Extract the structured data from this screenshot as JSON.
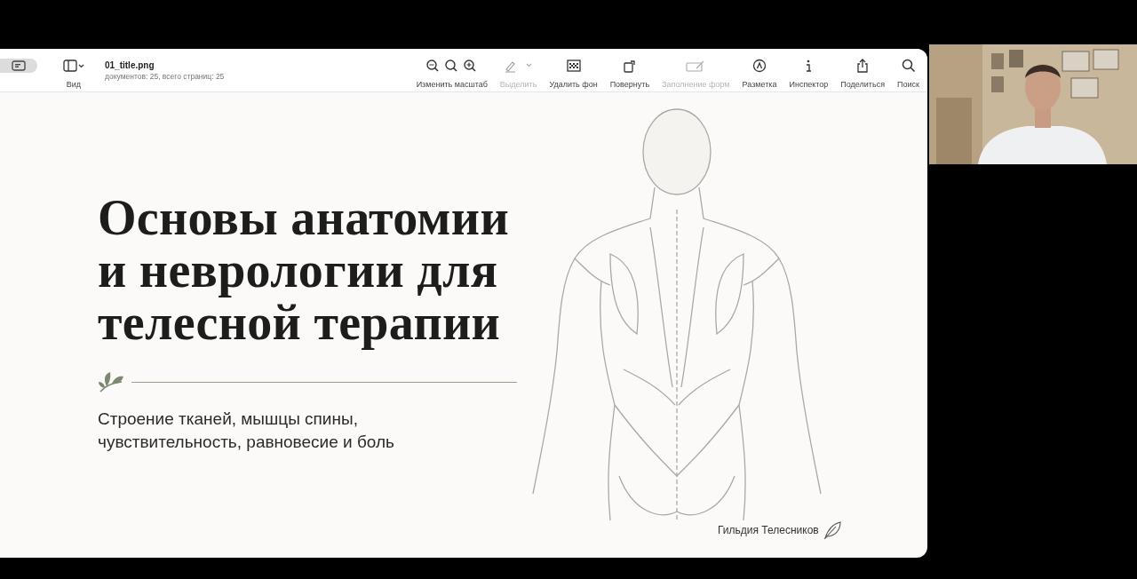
{
  "toolbar": {
    "view_label": "Вид",
    "document": {
      "title": "01_title.png",
      "subtitle": "документов: 25, всего страниц: 25"
    },
    "tools": [
      {
        "kind": "zoom",
        "label": "Изменить масштаб",
        "disabled": false
      },
      {
        "kind": "highlight",
        "label": "Выделить",
        "disabled": true
      },
      {
        "kind": "remove-background",
        "label": "Удалить фон",
        "disabled": false
      },
      {
        "kind": "rotate",
        "label": "Повернуть",
        "disabled": false
      },
      {
        "kind": "fill-form",
        "label": "Заполнение форм",
        "disabled": true
      },
      {
        "kind": "markup",
        "label": "Разметка",
        "disabled": false
      },
      {
        "kind": "inspector",
        "label": "Инспектор",
        "disabled": false
      },
      {
        "kind": "share",
        "label": "Поделиться",
        "disabled": false
      },
      {
        "kind": "search",
        "label": "Поиск",
        "disabled": false
      }
    ]
  },
  "slide": {
    "title": "Основы анатомии и неврологии для телесной терапии",
    "subtitle": "Строение тканей, мышцы спины, чувствительность, равновесие и боль",
    "author": "Гильдия Телесников"
  }
}
